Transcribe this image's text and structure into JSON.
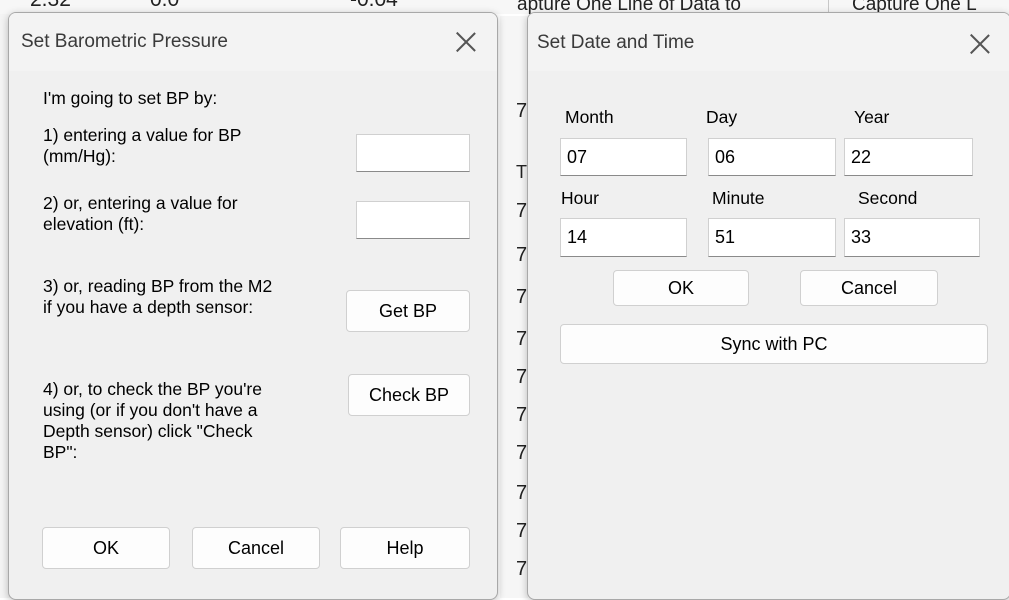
{
  "background": {
    "header_cells": [
      "2.32",
      "0.0",
      "-0.04",
      "apture One Line of Data to",
      "Capture One L"
    ],
    "left_col_marks": [
      "7",
      "T",
      "7",
      "7",
      "7",
      "7",
      "7",
      "7",
      "7",
      "7",
      "7",
      "7"
    ],
    "accent_color": "#f2cf49"
  },
  "bp_dialog": {
    "title": "Set Barometric Pressure",
    "intro": "I'm going to set BP by:",
    "option1_line1": "1) entering a value for BP",
    "option1_line2": "(mm/Hg):",
    "bp_value": "",
    "option2_line1": "2) or, entering a value for",
    "option2_line2": "elevation (ft):",
    "elevation_value": "",
    "option3_line1": "3) or, reading BP from the M2",
    "option3_line2": "if you have a depth sensor:",
    "get_bp_label": "Get BP",
    "option4_line1": "4) or, to check the BP you're",
    "option4_line2": "using (or if you don't have a",
    "option4_line3": "Depth sensor) click  \"Check",
    "option4_line4": "BP\":",
    "check_bp_label": "Check BP",
    "ok_label": "OK",
    "cancel_label": "Cancel",
    "help_label": "Help"
  },
  "dt_dialog": {
    "title": "Set Date and Time",
    "month_label": "Month",
    "day_label": "Day",
    "year_label": "Year",
    "month_value": "07",
    "day_value": "06",
    "year_value": "22",
    "hour_label": "Hour",
    "minute_label": "Minute",
    "second_label": "Second",
    "hour_value": "14",
    "minute_value": "51",
    "second_value": "33",
    "ok_label": "OK",
    "cancel_label": "Cancel",
    "sync_label": "Sync with PC"
  }
}
